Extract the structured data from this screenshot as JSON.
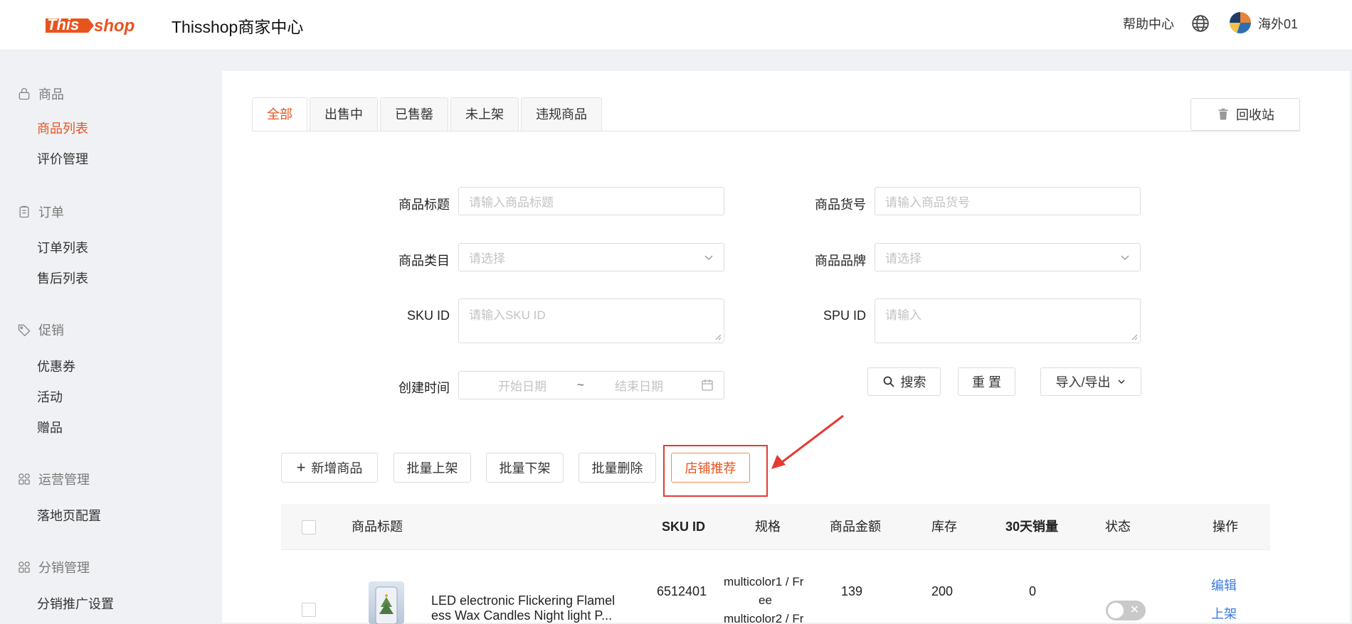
{
  "header": {
    "logo_text": "This shop",
    "title": "Thisshop商家中心",
    "help": "帮助中心",
    "user": "海外01",
    "icons": {
      "language": "globe-icon",
      "avatar": "avatar"
    }
  },
  "sidebar": {
    "groups": [
      {
        "label": "商品",
        "icon": "lock-icon",
        "items": [
          "商品列表",
          "评价管理"
        ]
      },
      {
        "label": "订单",
        "icon": "clipboard-icon",
        "items": [
          "订单列表",
          "售后列表"
        ]
      },
      {
        "label": "促销",
        "icon": "tag-icon",
        "items": [
          "优惠券",
          "活动",
          "赠品"
        ]
      },
      {
        "label": "运营管理",
        "icon": "grid-icon",
        "items": [
          "落地页配置"
        ]
      },
      {
        "label": "分销管理",
        "icon": "grid-icon",
        "items": [
          "分销推广设置"
        ]
      }
    ],
    "active_item": "商品列表"
  },
  "tabs": [
    "全部",
    "出售中",
    "已售罄",
    "未上架",
    "违规商品"
  ],
  "active_tab": "全部",
  "recycle_bin": "回收站",
  "form": {
    "title_label": "商品标题",
    "title_placeholder": "请输入商品标题",
    "code_label": "商品货号",
    "code_placeholder": "请输入商品货号",
    "category_label": "商品类目",
    "category_placeholder": "请选择",
    "brand_label": "商品品牌",
    "brand_placeholder": "请选择",
    "sku_label": "SKU ID",
    "sku_placeholder": "请输入SKU ID",
    "spu_label": "SPU ID",
    "spu_placeholder": "请输入",
    "time_label": "创建时间",
    "start_placeholder": "开始日期",
    "range_sep": "~",
    "end_placeholder": "结束日期"
  },
  "actions": {
    "search": "搜索",
    "reset": "重 置",
    "import_export": "导入/导出"
  },
  "toolbar": {
    "add": "新增商品",
    "batch_on": "批量上架",
    "batch_off": "批量下架",
    "batch_delete": "批量删除",
    "recommend": "店铺推荐"
  },
  "table": {
    "columns": [
      "商品标题",
      "SKU ID",
      "规格",
      "商品金额",
      "库存",
      "30天销量",
      "状态",
      "操作"
    ],
    "rows": [
      {
        "title_line1": "LED electronic Flickering Flamel",
        "title_line2": "ess Wax Candles Night light P...",
        "sku_id": "6512401",
        "spec_line1": "multicolor1 / Fr",
        "spec_line2": "ee",
        "spec_line3": "multicolor2 / Fr",
        "price": "139",
        "stock": "200",
        "sales": "0",
        "status_on": false,
        "op_edit": "编辑",
        "op_on": "上架"
      }
    ]
  }
}
